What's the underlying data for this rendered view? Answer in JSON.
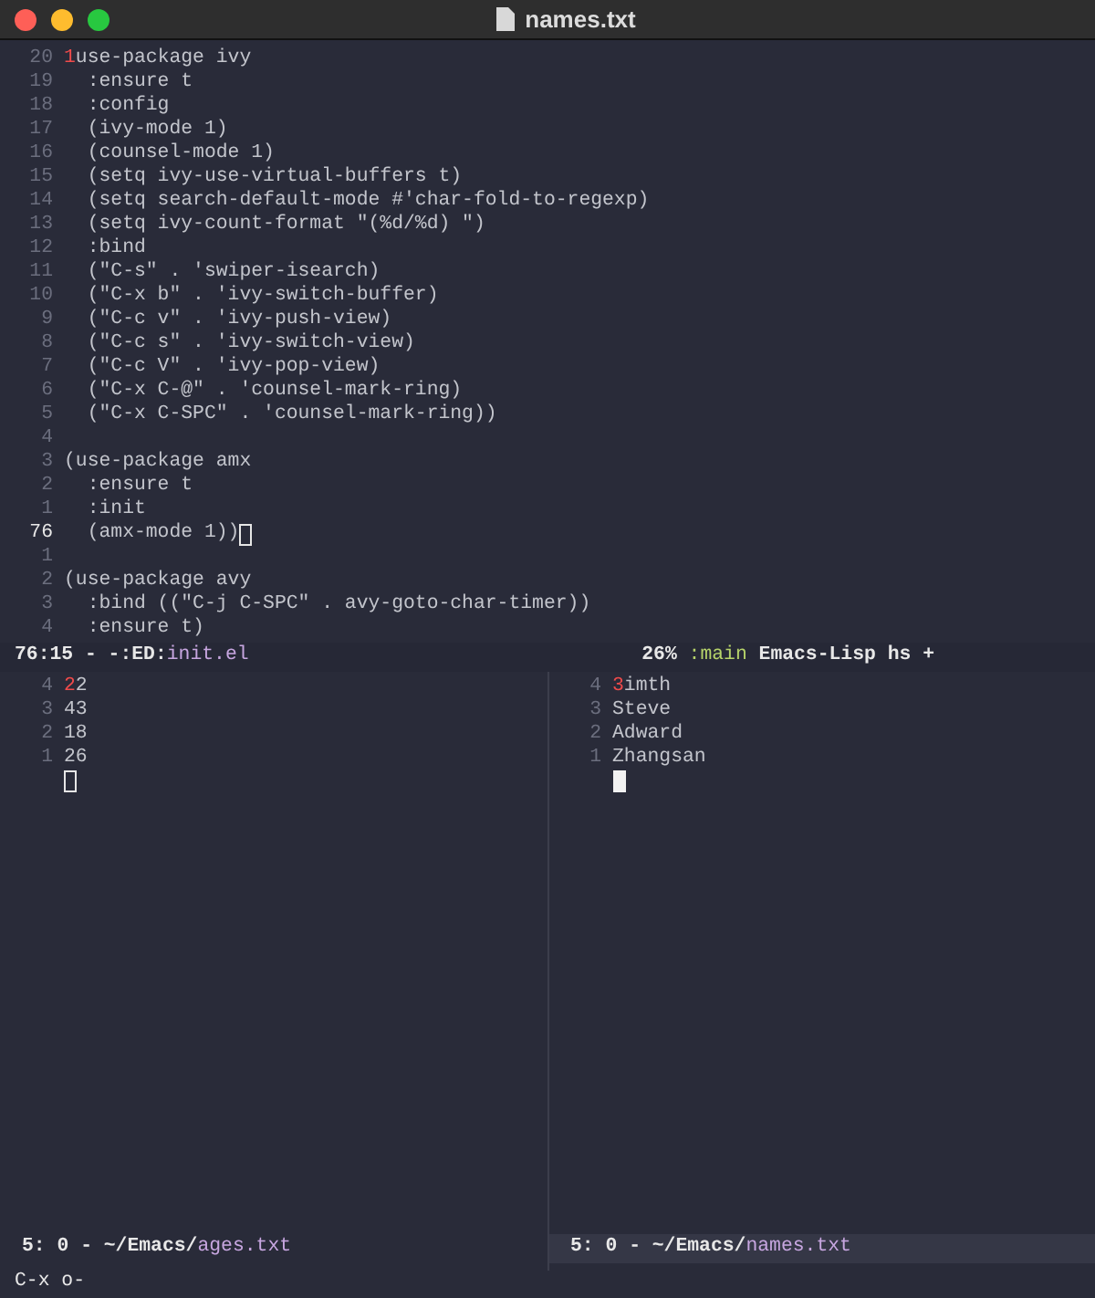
{
  "window": {
    "title": "names.txt"
  },
  "top_pane": {
    "active": false,
    "lines": [
      {
        "number": "20",
        "hint": "1",
        "text": "use-package ivy",
        "current": false
      },
      {
        "number": "19",
        "text": "  :ensure t",
        "current": false
      },
      {
        "number": "18",
        "text": "  :config",
        "current": false
      },
      {
        "number": "17",
        "text": "  (ivy-mode 1)",
        "current": false
      },
      {
        "number": "16",
        "text": "  (counsel-mode 1)",
        "current": false
      },
      {
        "number": "15",
        "text": "  (setq ivy-use-virtual-buffers t)",
        "current": false
      },
      {
        "number": "14",
        "text": "  (setq search-default-mode #'char-fold-to-regexp)",
        "current": false
      },
      {
        "number": "13",
        "text": "  (setq ivy-count-format \"(%d/%d) \")",
        "current": false
      },
      {
        "number": "12",
        "text": "  :bind",
        "current": false
      },
      {
        "number": "11",
        "text": "  (\"C-s\" . 'swiper-isearch)",
        "current": false
      },
      {
        "number": "10",
        "text": "  (\"C-x b\" . 'ivy-switch-buffer)",
        "current": false
      },
      {
        "number": "9",
        "text": "  (\"C-c v\" . 'ivy-push-view)",
        "current": false
      },
      {
        "number": "8",
        "text": "  (\"C-c s\" . 'ivy-switch-view)",
        "current": false
      },
      {
        "number": "7",
        "text": "  (\"C-c V\" . 'ivy-pop-view)",
        "current": false
      },
      {
        "number": "6",
        "text": "  (\"C-x C-@\" . 'counsel-mark-ring)",
        "current": false
      },
      {
        "number": "5",
        "text": "  (\"C-x C-SPC\" . 'counsel-mark-ring))",
        "current": false
      },
      {
        "number": "4",
        "current": false
      },
      {
        "number": "3",
        "text": "(use-package amx",
        "current": false
      },
      {
        "number": "2",
        "text": "  :ensure t",
        "current": false
      },
      {
        "number": "1",
        "text": "  :init",
        "current": false
      },
      {
        "number": "76",
        "text": "  (amx-mode 1))",
        "current": true
      },
      {
        "number": "1",
        "current": false
      },
      {
        "number": "2",
        "text": "(use-package avy",
        "current": false
      },
      {
        "number": "3",
        "text": "  :bind ((\"C-j C-SPC\" . avy-goto-char-timer))",
        "current": false
      },
      {
        "number": "4",
        "text": "  :ensure t)",
        "current": false
      }
    ]
  },
  "top_mode_line": {
    "position": "76:15 - -:ED:",
    "buffer": "init.el",
    "percent": "26%",
    "branch": ":main",
    "mode": "Emacs-Lisp hs +"
  },
  "bottom_panes": [
    {
      "active": false,
      "lines": [
        {
          "number": "4",
          "hint": "2",
          "text": "2"
        },
        {
          "number": "3",
          "text": "43"
        },
        {
          "number": "2",
          "text": "18"
        },
        {
          "number": "1",
          "text": "26"
        }
      ],
      "mode_line": {
        "path": "5: 0 - ~/Emacs/",
        "buffer": "ages.txt"
      }
    },
    {
      "active": true,
      "lines": [
        {
          "number": "4",
          "hint": "3",
          "text": "imth"
        },
        {
          "number": "3",
          "text": "Steve"
        },
        {
          "number": "2",
          "text": "Adward"
        },
        {
          "number": "1",
          "text": "Zhangsan"
        }
      ],
      "mode_line": {
        "path": "5: 0 - ~/Emacs/",
        "buffer": "names.txt"
      }
    }
  ],
  "minibuffer": "C-x o-"
}
